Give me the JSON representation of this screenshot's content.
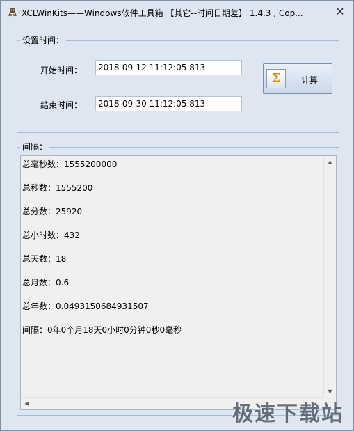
{
  "window": {
    "title": "XCLWinKits——Windows软件工具箱 【其它--时间日期差】 1.4.3 , Cop...",
    "close_glyph": "✕"
  },
  "settings": {
    "group_label": "设置时间：",
    "start_label": "开始时间：",
    "start_value": "2018-09-12 11:12:05.813",
    "end_label": "结束时间：",
    "end_value": "2018-09-30 11:12:05.813",
    "calc_button_label": "计算",
    "calc_button_glyph": "Σ"
  },
  "interval": {
    "group_label": "间隔：",
    "lines": [
      "总毫秒数：1555200000",
      "总秒数：1555200",
      "总分数：25920",
      "总小时数：432",
      "总天数：18",
      "总月数：0.6",
      "总年数：0.0493150684931507",
      "间隔：0年0个月18天0小时0分钟0秒0毫秒"
    ]
  },
  "scrollbar": {
    "up_glyph": "▲",
    "down_glyph": "▼",
    "left_glyph": "◀"
  },
  "watermark": {
    "text": "极速下载站"
  },
  "colors": {
    "window_bg": "#dde6f1",
    "sigma": "#e08a00",
    "group_border": "#a9bcd2"
  }
}
